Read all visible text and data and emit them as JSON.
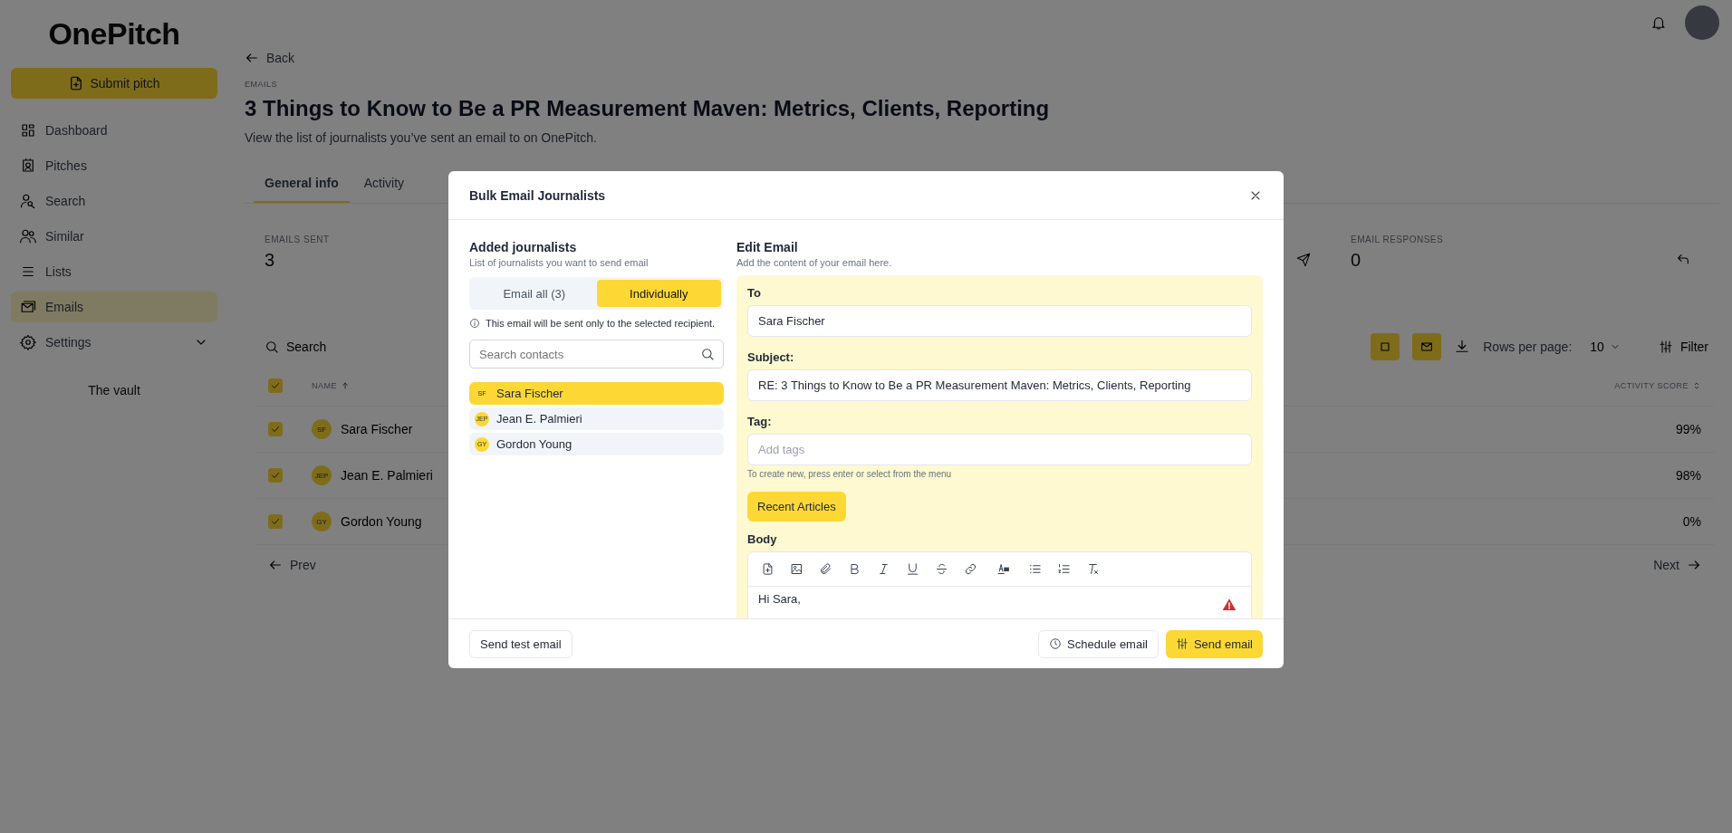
{
  "sidebar": {
    "logo": "OnePitch",
    "submit_label": "Submit pitch",
    "vault": "The vault",
    "items": [
      {
        "label": "Dashboard",
        "selected": false
      },
      {
        "label": "Pitches",
        "selected": false
      },
      {
        "label": "Search",
        "selected": false
      },
      {
        "label": "Similar",
        "selected": false
      },
      {
        "label": "Lists",
        "selected": false
      },
      {
        "label": "Emails",
        "selected": true
      },
      {
        "label": "Settings",
        "selected": false,
        "expanded": false
      }
    ]
  },
  "page": {
    "back": "Back",
    "breadcrumb": "EMAILS",
    "title": "3 Things to Know to Be a PR Measurement Maven: Metrics, Clients, Reporting",
    "subtitle": "View the list of journalists you’ve sent an email to on OnePitch.",
    "tabs": [
      {
        "label": "General info",
        "selected": true
      },
      {
        "label": "Activity",
        "selected": false
      }
    ]
  },
  "stats": [
    {
      "label": "EMAILS SENT",
      "value": "3"
    },
    {
      "label": "EMAIL RESPONSES",
      "value": "0"
    }
  ],
  "table": {
    "search_placeholder": "Search",
    "rows_per_page_label": "Rows per page:",
    "rows_per_page": "10",
    "filter": "Filter",
    "all_checked": true,
    "name_column": "NAME",
    "score_column": "ACTIVITY SCORE",
    "prev": "Prev",
    "next": "Next",
    "rows": [
      {
        "checked": true,
        "initials": "SF",
        "name": "Sara Fischer",
        "score": "99%"
      },
      {
        "checked": true,
        "initials": "JEP",
        "name": "Jean E. Palmieri",
        "score": "98%"
      },
      {
        "checked": true,
        "initials": "GY",
        "name": "Gordon Young",
        "score": "0%"
      }
    ]
  },
  "modal": {
    "title": "Bulk Email Journalists",
    "journalists": {
      "heading": "Added journalists",
      "subheading": "List of journalists you want to send email",
      "mode_note": "This email will be sent only to the selected recipient.",
      "search_placeholder": "Search contacts",
      "modes": [
        {
          "label": "Email all (3)",
          "selected": false
        },
        {
          "label": "Individually",
          "selected": true
        }
      ],
      "contacts": [
        {
          "initials": "SF",
          "name": "Sara Fischer",
          "selected": true
        },
        {
          "initials": "JEP",
          "name": "Jean E. Palmieri",
          "selected": false
        },
        {
          "initials": "GY",
          "name": "Gordon Young",
          "selected": false
        }
      ]
    },
    "editor": {
      "heading": "Edit Email",
      "subheading": "Add the content of your email here.",
      "to_label": "To",
      "to_value": "Sara Fischer",
      "subject_label": "Subject:",
      "subject_value": "RE: 3 Things to Know to Be a PR Measurement Maven: Metrics, Clients, Reporting",
      "tag_label": "Tag:",
      "tag_placeholder": "Add tags",
      "tag_hint": "To create new, press enter or select from the menu",
      "articles_button": "Recent Articles",
      "body_label": "Body",
      "body_text": "Hi Sara,"
    },
    "footer": {
      "test_button": "Send test email",
      "schedule_button": "Schedule email",
      "send_button": "Send email"
    }
  }
}
